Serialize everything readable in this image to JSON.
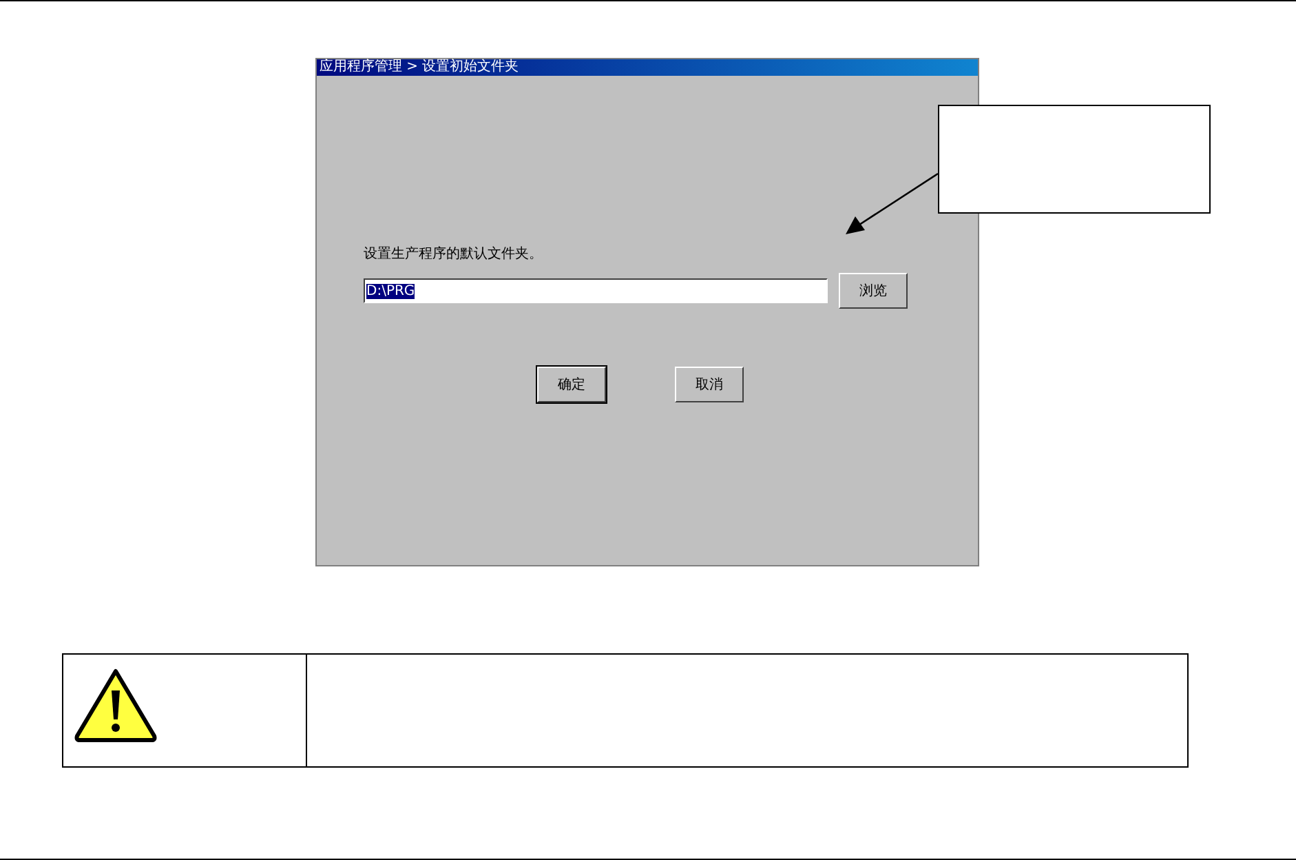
{
  "window": {
    "title": "应用程序管理 > 设置初始文件夹"
  },
  "prompt": "设置生产程序的默认文件夹。",
  "folder_field": {
    "value": "D:\\PRG",
    "selected": true
  },
  "browse_button": "浏览",
  "buttons": [
    "确定",
    "取消"
  ]
}
